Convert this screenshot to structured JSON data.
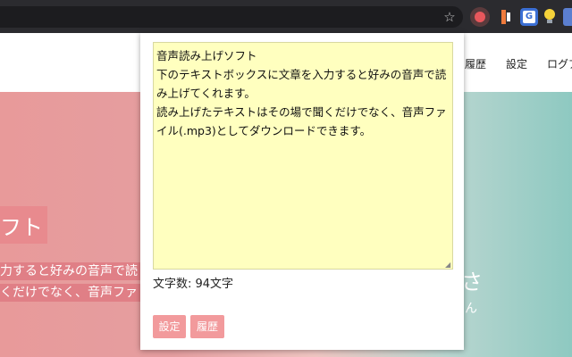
{
  "browser": {
    "toolbar": {
      "bookmark_star": "☆"
    },
    "extensions": [
      "tts-extension-icon",
      "audio-extension-icon",
      "google-translate-icon",
      "idea-bulb-icon",
      "extension-icon"
    ]
  },
  "website": {
    "nav": {
      "history": "履歴",
      "settings": "設定",
      "login": "ログア"
    },
    "hero": {
      "title_fragment": "フト",
      "line1": "力すると好みの音声で読",
      "line2": "くだけでなく、音声ファ",
      "right_char": "さ",
      "right_char2": "ん"
    }
  },
  "popup": {
    "textarea_value": "音声読み上げソフト\n下のテキストボックスに文章を入力すると好みの音声で読み上げてくれます。\n読み上げたテキストはその場で聞くだけでなく、音声ファイル(.mp3)としてダウンロードできます。",
    "char_count": "文字数: 94文字",
    "settings_button": "設定",
    "history_button": "履歴"
  },
  "colors": {
    "accent": "#f29a9c",
    "textarea_bg": "#ffffbf",
    "toolbar_bg": "#2b2b2f"
  }
}
